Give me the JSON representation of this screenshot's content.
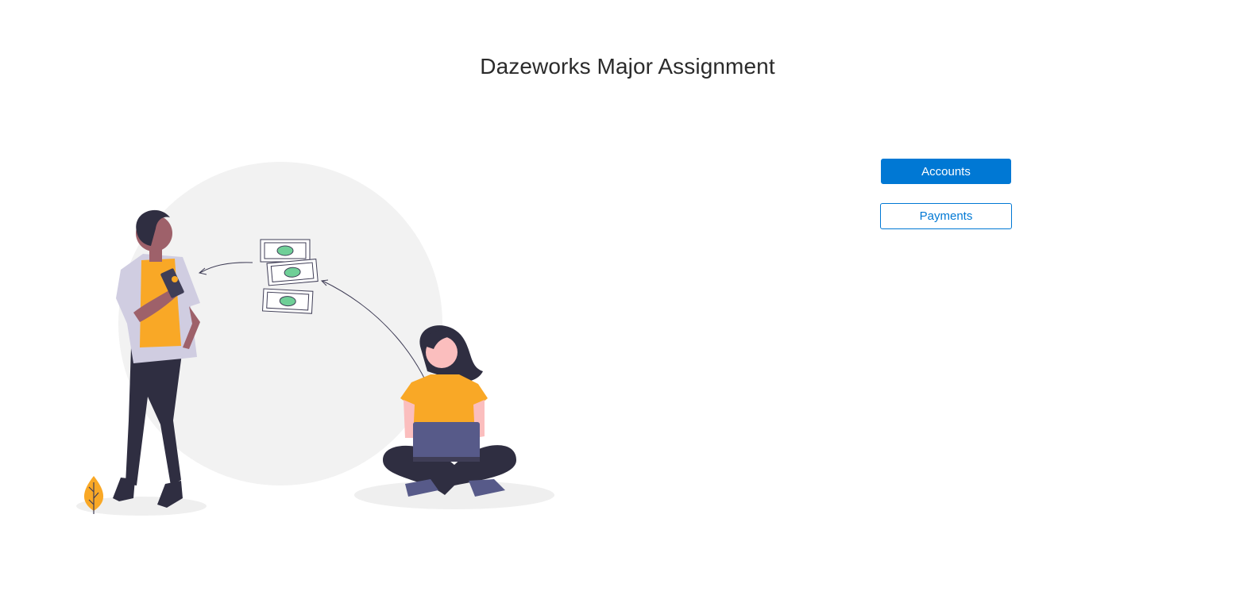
{
  "header": {
    "title": "Dazeworks Major Assignment"
  },
  "actions": {
    "accounts_label": "Accounts",
    "payments_label": "Payments"
  },
  "illustration": {
    "icon": "money-transfer-illustration"
  },
  "colors": {
    "accent": "#0078d4",
    "illustration_yellow": "#f9a826",
    "illustration_dark": "#2f2e41",
    "illustration_circle": "#f2f2f2",
    "illustration_laptop": "#575a89"
  }
}
